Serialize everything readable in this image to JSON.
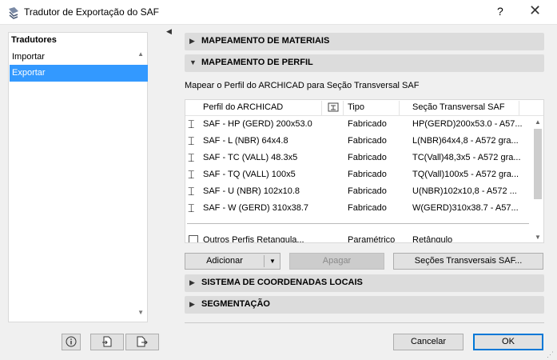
{
  "window": {
    "title": "Tradutor de Exportação do SAF",
    "help_label": "?",
    "close_label": "✕"
  },
  "sidebar": {
    "header": "Tradutores",
    "items": [
      {
        "label": "Importar"
      },
      {
        "label": "Exportar"
      }
    ]
  },
  "sections": {
    "materiais": "MAPEAMENTO DE MATERIAIS",
    "perfil": "MAPEAMENTO DE PERFIL",
    "coordenadas": "SISTEMA DE COORDENADAS LOCAIS",
    "segmentacao": "SEGMENTAÇÃO"
  },
  "perfil": {
    "description": "Mapear o Perfil do ARCHICAD para Seção Transversal SAF",
    "columns": {
      "perfil": "Perfil do ARCHICAD",
      "tipo": "Tipo",
      "secao": "Seção Transversal SAF"
    },
    "rows": [
      {
        "perfil": "SAF - HP (GERD) 200x53.0",
        "tipo": "Fabricado",
        "secao": "HP(GERD)200x53.0 - A57..."
      },
      {
        "perfil": "SAF - L (NBR) 64x4.8",
        "tipo": "Fabricado",
        "secao": "L(NBR)64x4,8 - A572 gra..."
      },
      {
        "perfil": "SAF - TC (VALL) 48.3x5",
        "tipo": "Fabricado",
        "secao": "TC(Vall)48,3x5 - A572 gra..."
      },
      {
        "perfil": "SAF - TQ (VALL) 100x5",
        "tipo": "Fabricado",
        "secao": "TQ(Vall)100x5 - A572 gra..."
      },
      {
        "perfil": "SAF - U (NBR) 102x10.8",
        "tipo": "Fabricado",
        "secao": "U(NBR)102x10,8 - A572 ..."
      },
      {
        "perfil": "SAF - W (GERD) 310x38.7",
        "tipo": "Fabricado",
        "secao": "W(GERD)310x38.7 - A57..."
      }
    ],
    "other_row": {
      "perfil": "Outros Perfis Retangula...",
      "tipo": "Paramétrico",
      "secao": "Retângulo"
    },
    "buttons": {
      "adicionar": "Adicionar",
      "apagar": "Apagar",
      "secoes": "Seções Transversais SAF..."
    }
  },
  "footer": {
    "cancel": "Cancelar",
    "ok": "OK"
  }
}
